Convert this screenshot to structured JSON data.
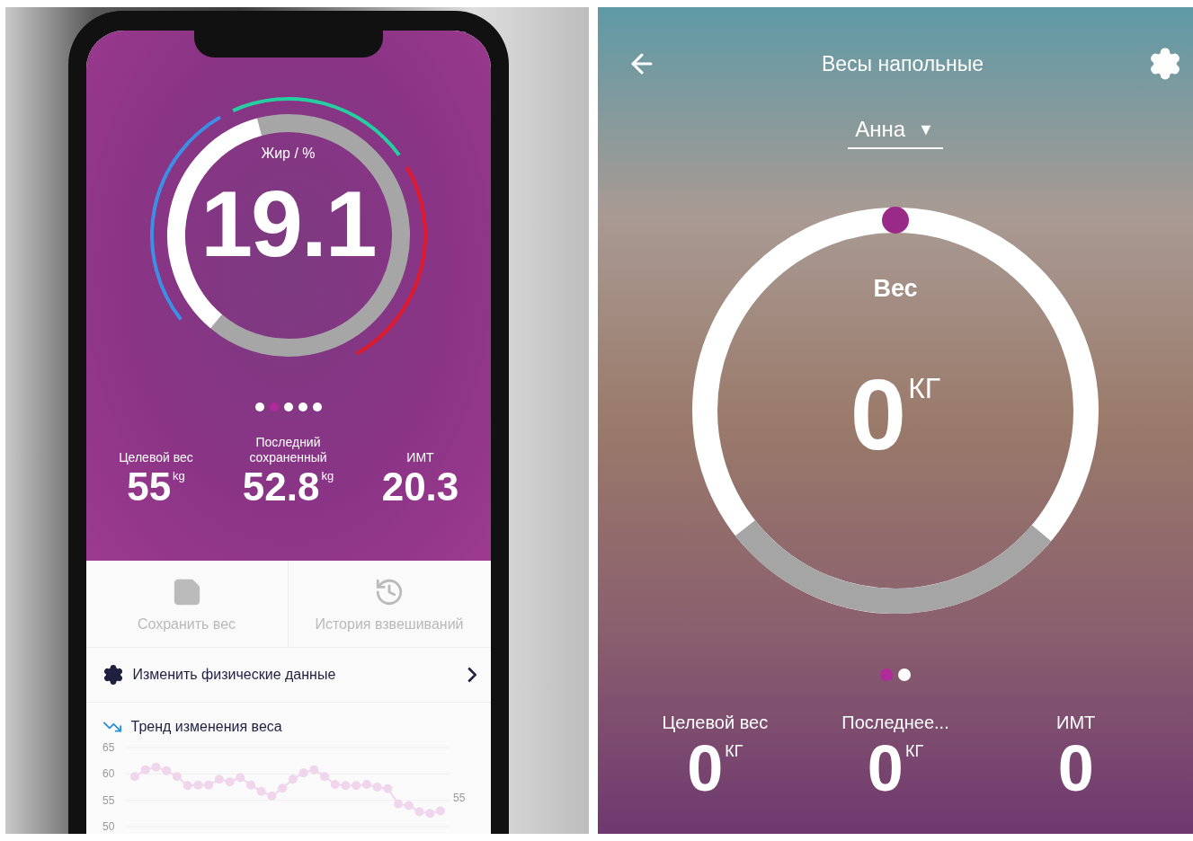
{
  "phone_app": {
    "gauge": {
      "label": "Жир / %",
      "value": "19.1"
    },
    "page_dots": [
      {
        "selected": false
      },
      {
        "selected": true
      },
      {
        "selected": false
      },
      {
        "selected": false
      },
      {
        "selected": false
      }
    ],
    "stats": [
      {
        "label": "Целевой вес",
        "value": "55",
        "unit": "kg"
      },
      {
        "label": "Последний сохраненный",
        "value": "52.8",
        "unit": "kg"
      },
      {
        "label": "ИМТ",
        "value": "20.3"
      }
    ],
    "actions": [
      {
        "kind": "save",
        "label": "Сохранить вес"
      },
      {
        "kind": "history",
        "label": "История взвешиваний"
      }
    ],
    "menu": [
      {
        "kind": "settings",
        "label": "Изменить физические данные",
        "chevron": true
      },
      {
        "kind": "trend",
        "label": "Тренд изменения веса",
        "chevron": false
      }
    ],
    "chart_data": {
      "type": "line",
      "yticks": [
        65,
        60,
        55,
        50
      ],
      "ylim": [
        50,
        65
      ],
      "series": [
        {
          "color": "#f0d6ec",
          "marker": "circle",
          "values": [
            59.5,
            60.8,
            61.3,
            60.6,
            59.5,
            57.8,
            57.9,
            57.9,
            59.0,
            58.5,
            59.3,
            57.9,
            56.7,
            55.8,
            57.3,
            59.0,
            60.2,
            60.8,
            59.5,
            58.0,
            57.8,
            57.8,
            58.0,
            57.5,
            57.2,
            54.3,
            54.0,
            52.8,
            52.5,
            53.0
          ]
        }
      ],
      "annotations": [
        "55"
      ]
    }
  },
  "scale_app": {
    "title": "Весы напольные",
    "user": "Анна",
    "dropdown_glyph": "▼",
    "gauge": {
      "label": "Вес",
      "value": "0",
      "unit": "КГ"
    },
    "page_dots": [
      {
        "selected": true
      },
      {
        "selected": false
      }
    ],
    "stats": [
      {
        "label": "Целевой вес",
        "value": "0",
        "unit": "КГ"
      },
      {
        "label": "Последнее...",
        "value": "0",
        "unit": "КГ"
      },
      {
        "label": "ИМТ",
        "value": "0"
      }
    ]
  }
}
